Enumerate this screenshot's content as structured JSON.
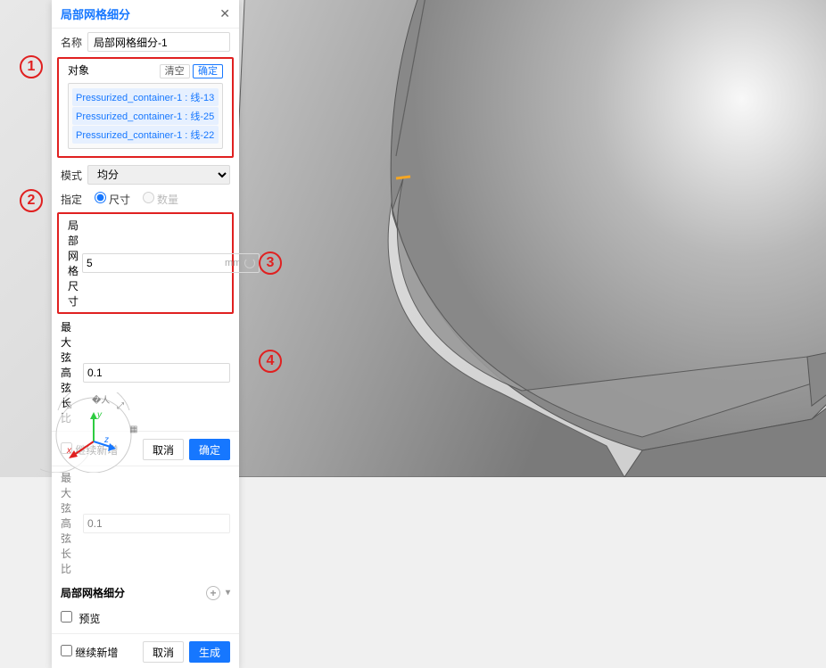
{
  "panel": {
    "title": "局部网格细分",
    "name_label": "名称",
    "name_value": "局部网格细分-1",
    "objects": {
      "label": "对象",
      "clear_btn": "清空",
      "confirm_btn": "确定",
      "items": [
        "Pressurized_container-1 : 线-13",
        "Pressurized_container-1 : 线-25",
        "Pressurized_container-1 : 线-22"
      ]
    },
    "mode_label": "模式",
    "mode_value": "均分",
    "specify_label": "指定",
    "specify_size": "尺寸",
    "specify_count": "数量",
    "local_size_label": "局部网格尺寸",
    "local_size_value": "5",
    "local_size_unit": "mm",
    "chord_label": "最大弦高弦长比",
    "chord_value": "0.1",
    "continue_add": "继续新增",
    "cancel_btn": "取消",
    "ok_btn": "确定",
    "trunc_label": "最大弦高弦长比",
    "trunc_value": "0.1",
    "section_title": "局部网格细分",
    "preview": "预览",
    "generate_btn": "生成"
  },
  "annotations": {
    "a1": "1",
    "a2": "2",
    "a3": "3",
    "a4": "4"
  }
}
